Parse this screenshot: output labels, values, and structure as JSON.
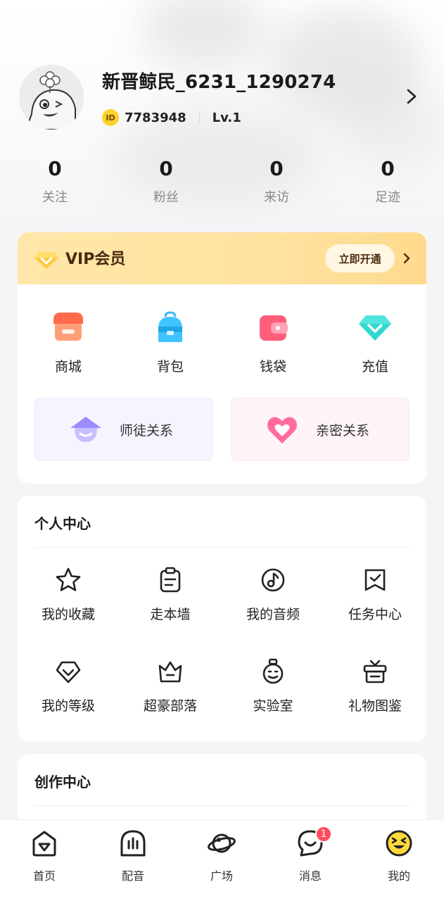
{
  "profile": {
    "username": "新晋鲸民_6231_1290274",
    "id_label": "ID",
    "id_value": "7783948",
    "level": "Lv.1"
  },
  "stats": [
    {
      "value": "0",
      "label": "关注"
    },
    {
      "value": "0",
      "label": "粉丝"
    },
    {
      "value": "0",
      "label": "来访"
    },
    {
      "value": "0",
      "label": "足迹"
    }
  ],
  "vip": {
    "title": "VIP会员",
    "open_label": "立即开通"
  },
  "quick": [
    {
      "label": "商城",
      "icon": "shop-icon"
    },
    {
      "label": "背包",
      "icon": "backpack-icon"
    },
    {
      "label": "钱袋",
      "icon": "wallet-icon"
    },
    {
      "label": "充值",
      "icon": "diamond-icon"
    }
  ],
  "relations": [
    {
      "label": "师徒关系",
      "icon": "master-hat-icon"
    },
    {
      "label": "亲密关系",
      "icon": "heart-icon"
    }
  ],
  "personal": {
    "title": "个人中心",
    "items": [
      {
        "label": "我的收藏",
        "icon": "star-icon"
      },
      {
        "label": "走本墙",
        "icon": "clipboard-icon"
      },
      {
        "label": "我的音频",
        "icon": "music-note-icon"
      },
      {
        "label": "任务中心",
        "icon": "task-flag-icon"
      },
      {
        "label": "我的等级",
        "icon": "level-gem-icon"
      },
      {
        "label": "超豪部落",
        "icon": "crown-icon"
      },
      {
        "label": "实验室",
        "icon": "flask-icon"
      },
      {
        "label": "礼物图鉴",
        "icon": "gift-icon"
      }
    ]
  },
  "creation": {
    "title": "创作中心"
  },
  "nav": [
    {
      "label": "首页",
      "icon": "home-icon"
    },
    {
      "label": "配音",
      "icon": "dubbing-icon"
    },
    {
      "label": "广场",
      "icon": "planet-icon"
    },
    {
      "label": "消息",
      "icon": "message-icon",
      "badge": "1"
    },
    {
      "label": "我的",
      "icon": "me-face-icon"
    }
  ]
}
